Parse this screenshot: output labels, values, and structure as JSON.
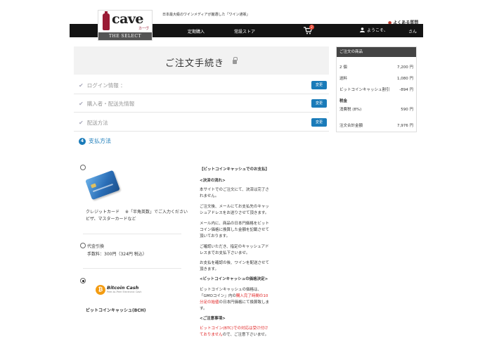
{
  "header": {
    "logo_word": "cave",
    "logo_kana": "カーヴ",
    "logo_sub": "THE SELECT",
    "tagline": "日本最大級のワインメディアが厳選した「ワイン通販」",
    "faq": "よくある質問",
    "nav": {
      "teiki": "定期購入",
      "store": "常設ストア",
      "cart_count": "2",
      "welcome": "ようこそ、",
      "san": "さん"
    }
  },
  "main": {
    "title": "ご注文手続き",
    "steps": [
      {
        "label": "ログイン情報 ：",
        "edit": "変更"
      },
      {
        "label": "購入者・配送先情報",
        "edit": "変更"
      },
      {
        "label": "配送方法",
        "edit": "変更"
      }
    ],
    "step4": {
      "num": "4",
      "label": "支払方法"
    },
    "payments": {
      "credit": {
        "label": "クレジットカード",
        "note": "※「半角英数」でご入力ください",
        "brands": "ビザ、マスターカードなど"
      },
      "cod": {
        "label": "代金引換",
        "fee": "手数料：300円（324円 税込）"
      },
      "bch": {
        "logo": "Bitcoin Cash",
        "logo_sub": "Peer-to-Peer Electronic Cash",
        "label": "ビットコインキャッシュ(BCH)"
      }
    },
    "info": {
      "heading": "【ビットコインキャッシュでのお支払】",
      "flow_h": "<決済の流れ>",
      "p1": "本サイトでのご注文にて、決済は完了されません。",
      "p2": "ご注文後、メールにてお支払先のキャッシュアドレスをお送りさせて頂きます。",
      "p3": "メール内に、商品の日本円価格をビットコイン価格に換算した金額を記載させて頂いております。",
      "p4": "ご確認いただき、指定のキャッシュアドレスまでお支払下さいませ。",
      "p5": "お支払を確認の後、ワインを配送させて頂きます。",
      "rate_h": "<ビットコインキャッシュの価格決定>",
      "r1": "ビットコインキャッシュの価格は、",
      "r2a": "「GMOコイン」内の",
      "r2b": "購入完了時間の10分足の始値",
      "r2c": "の日本円価格にて換算致します。",
      "note_h": "<ご注意事項>",
      "n1": "ビットコイン(BTC)での対応は受け付けておりません",
      "n2": "ので、ご注意下さいませ。"
    }
  },
  "summary": {
    "header": "ご注文の商品",
    "items_label": "2 個",
    "items_value": "7,200 円",
    "shipping_label": "送料",
    "shipping_value": "1,080 円",
    "discount_label": "ビットコインキャッシュ割引",
    "discount_value": "-894 円",
    "tax_h": "税金",
    "tax_label": "消費税 (8%)",
    "tax_value": "590 円",
    "total_label": "注文合計金額",
    "total_value": "7,976 円"
  }
}
